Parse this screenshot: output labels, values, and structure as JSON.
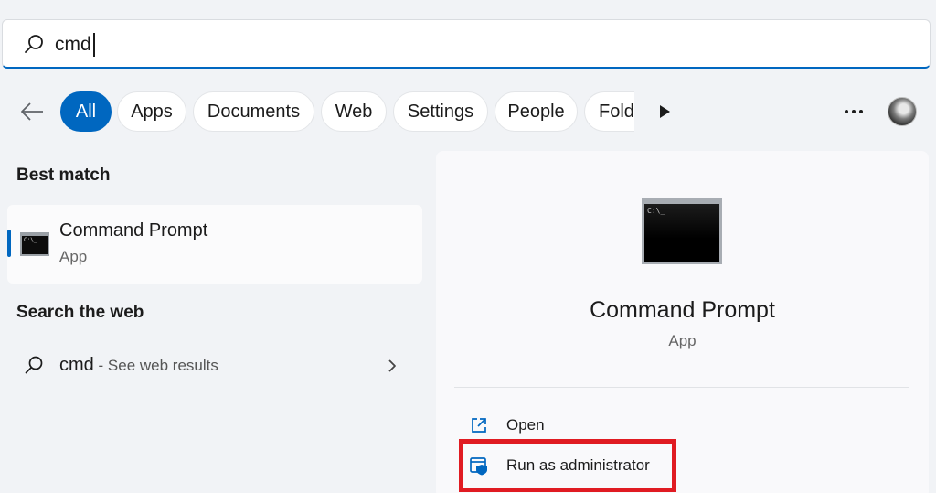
{
  "search": {
    "query": "cmd"
  },
  "filters": [
    {
      "label": "All",
      "active": true
    },
    {
      "label": "Apps"
    },
    {
      "label": "Documents"
    },
    {
      "label": "Web"
    },
    {
      "label": "Settings"
    },
    {
      "label": "People"
    },
    {
      "label": "Fold"
    }
  ],
  "best_match": {
    "section_title": "Best match",
    "title": "Command Prompt",
    "type": "App"
  },
  "web_search": {
    "section_title": "Search the web",
    "query": "cmd",
    "suffix": " - See web results"
  },
  "detail": {
    "title": "Command Prompt",
    "type": "App",
    "actions": [
      {
        "label": "Open",
        "icon": "open-external-icon"
      },
      {
        "label": "Run as administrator",
        "icon": "shield-admin-icon",
        "highlighted": true
      }
    ]
  },
  "colors": {
    "accent": "#0067c0",
    "highlight": "#e01b22"
  },
  "icon_text": "C:\\_"
}
